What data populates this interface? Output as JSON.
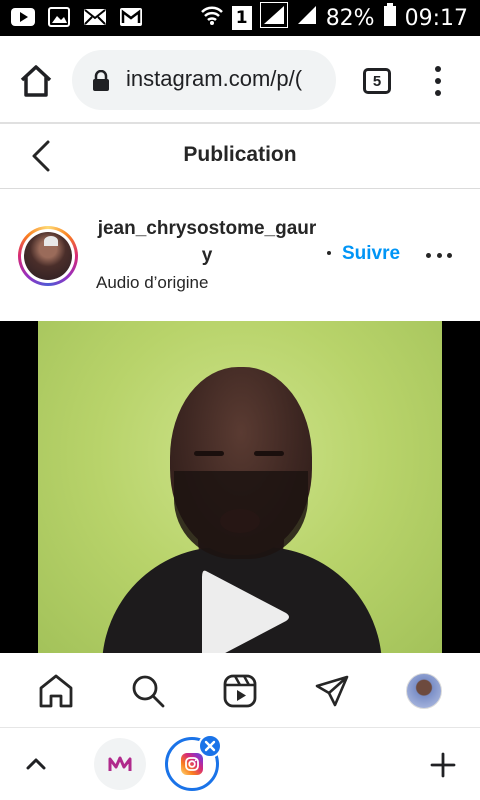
{
  "status_bar": {
    "battery_percent": "82%",
    "time": "09:17",
    "sim_slot": "1"
  },
  "browser": {
    "url": "instagram.com/p/(",
    "tab_count": "5"
  },
  "page": {
    "title": "Publication"
  },
  "post": {
    "username": "jean_chrysostome_gaury",
    "audio": "Audio d’origine",
    "follow_label": "Suivre"
  },
  "ig_nav": {
    "items": [
      "home-icon",
      "search-icon",
      "reels-icon",
      "direct-icon",
      "profile-avatar"
    ]
  },
  "colors": {
    "follow_blue": "#0095f6",
    "tab_accent": "#1a73e8",
    "video_bg": "#b8d36a"
  }
}
